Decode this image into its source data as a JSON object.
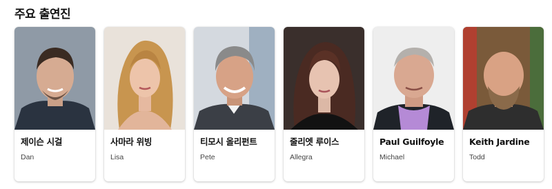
{
  "section": {
    "title": "주요 출연진"
  },
  "cast": [
    {
      "name": "제이슨 시걸",
      "role": "Dan"
    },
    {
      "name": "사마라 위빙",
      "role": "Lisa"
    },
    {
      "name": "티모시 올리펀트",
      "role": "Pete"
    },
    {
      "name": "줄리엣 루이스",
      "role": "Allegra"
    },
    {
      "name": "Paul Guilfoyle",
      "role": "Michael"
    },
    {
      "name": "Keith Jardine",
      "role": "Todd"
    }
  ]
}
